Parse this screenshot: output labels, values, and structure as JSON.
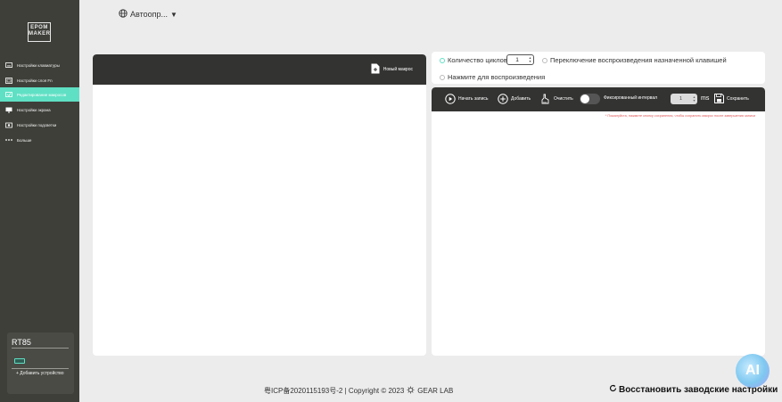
{
  "app": {
    "logo_text": "EPOM\nMAKER"
  },
  "sidebar": {
    "items": [
      {
        "label": "Настройки клавиатуры",
        "icon": "keyboard-icon"
      },
      {
        "label": "Настройки слоя Fn",
        "icon": "fn-layer-icon"
      },
      {
        "label": "Редактирование макросов",
        "icon": "macro-icon",
        "active": true
      },
      {
        "label": "Настройки экрана",
        "icon": "monitor-icon"
      },
      {
        "label": "Настройки подсветки",
        "icon": "light-icon"
      },
      {
        "label": "Больше",
        "icon": "more-icon"
      }
    ],
    "device": {
      "name": "RT85",
      "add_label": "+ Добавить устройство"
    }
  },
  "header": {
    "language_label": "Автоопр..."
  },
  "macro_list": {
    "new_macro_label": "Новый макрос"
  },
  "options": {
    "loop_count_label": "Количество циклов",
    "loop_count_value": "1",
    "toggle_key_label": "Переключение воспроизведения назначенной клавишей",
    "press_play_label": "Нажмите для воспроизведения"
  },
  "toolbar": {
    "record_label": "Начать запись",
    "add_label": "Добавить",
    "clear_label": "Очистить",
    "fixed_interval_label": "Фиксированный интервал",
    "interval_value": "1",
    "interval_unit": "ms",
    "save_label": "Сохранить",
    "hint": "* Пожалуйста, нажмите кнопку сохранения, чтобы сохранить макрос после завершения записи"
  },
  "footer": {
    "icp": "粤ICP备2020115193号-2",
    "copyright": "| Copyright © 2023",
    "brand": "GEAR LAB",
    "restore_label": "Восстановить заводские настройки"
  },
  "ai_badge": "AI",
  "colors": {
    "accent": "#5fe0c4",
    "sidebar_bg": "#3e3f39",
    "toolbar_bg": "#333432",
    "hint": "#e05555"
  }
}
